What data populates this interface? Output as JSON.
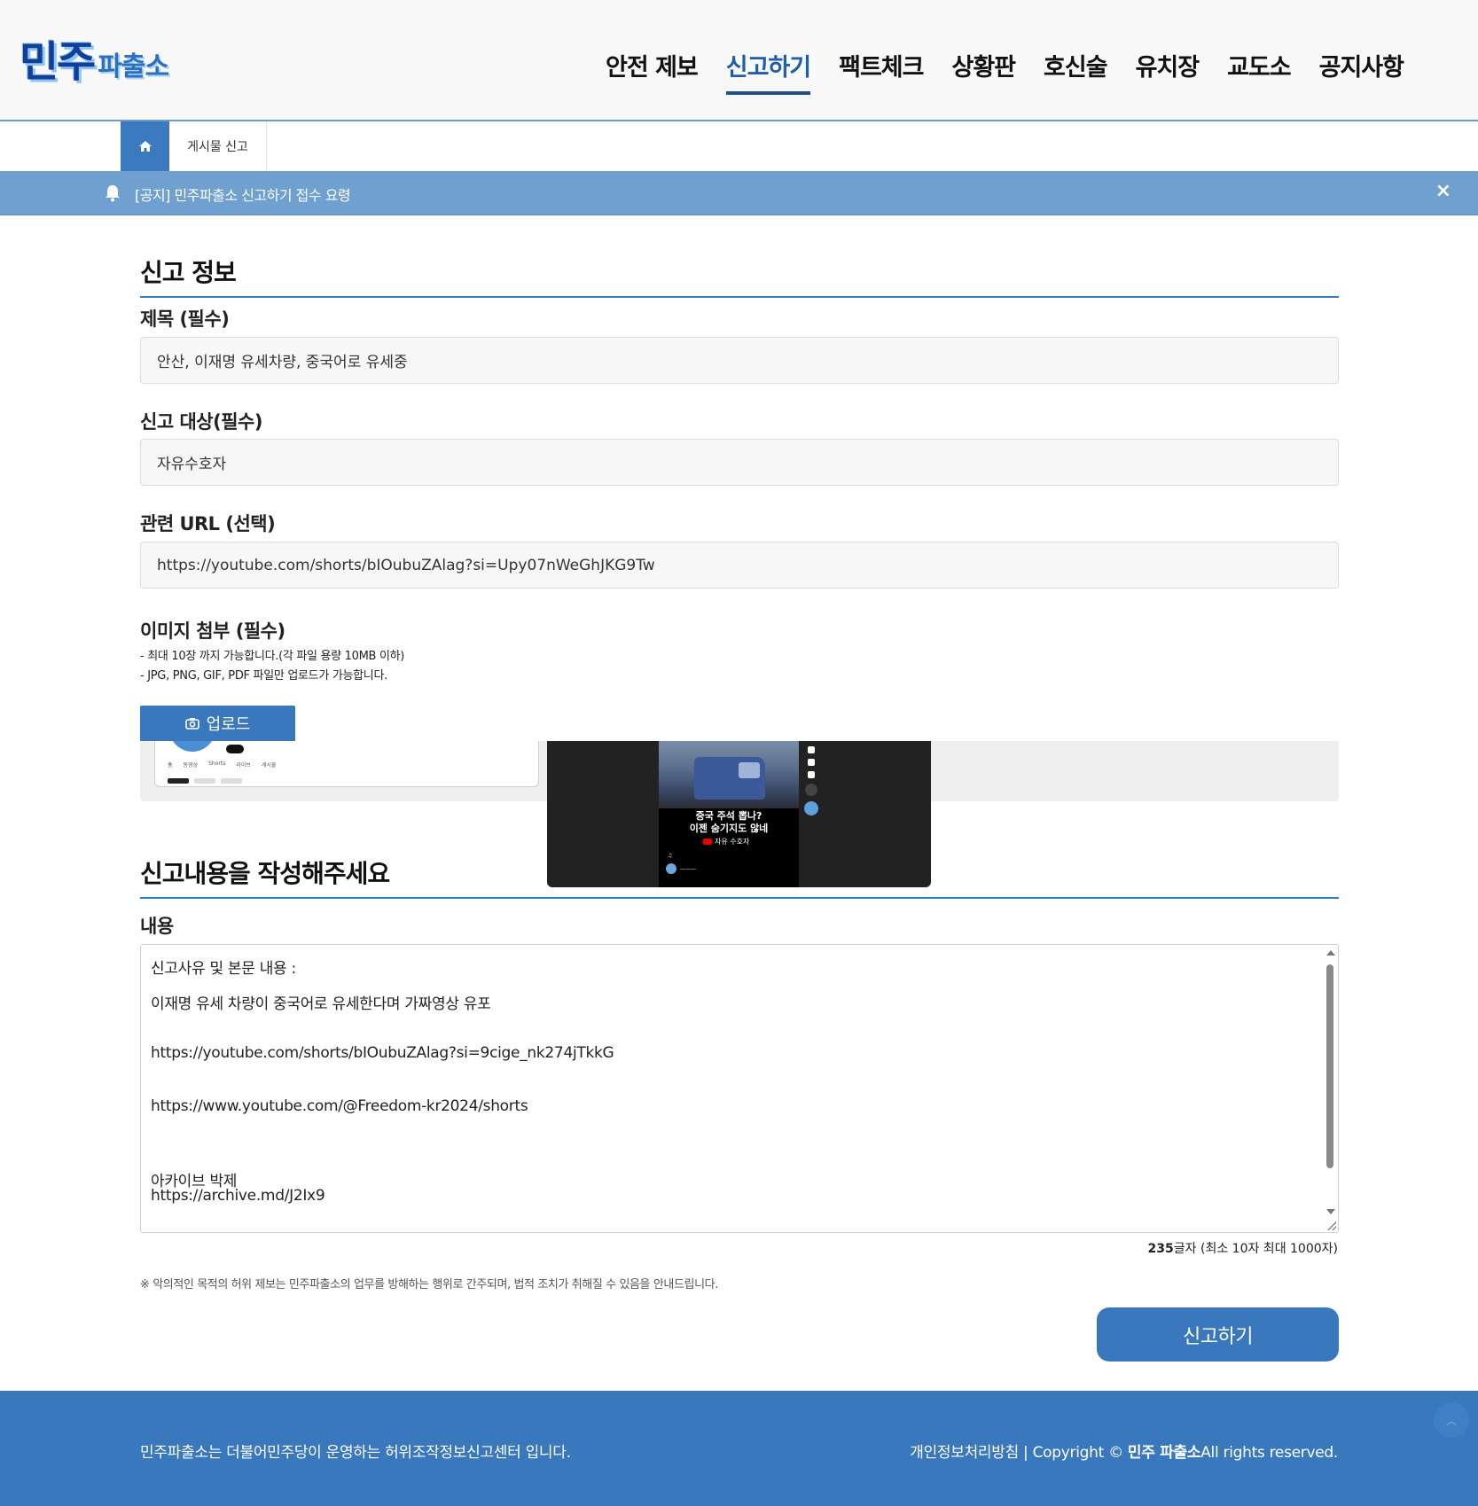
{
  "header": {
    "logo_main": "민주",
    "logo_sub": "파출소",
    "nav": [
      {
        "label": "안전 제보",
        "active": false
      },
      {
        "label": "신고하기",
        "active": true
      },
      {
        "label": "팩트체크",
        "active": false
      },
      {
        "label": "상황판",
        "active": false
      },
      {
        "label": "호신술",
        "active": false
      },
      {
        "label": "유치장",
        "active": false
      },
      {
        "label": "교도소",
        "active": false
      },
      {
        "label": "공지사항",
        "active": false
      }
    ]
  },
  "breadcrumb": {
    "home_icon": "home-icon",
    "current": "게시물 신고"
  },
  "notice": {
    "text": "[공지] 민주파출소 신고하기 접수 요령",
    "close": "×"
  },
  "report_info": {
    "section_title": "신고 정보",
    "title_label": "제목 (필수)",
    "title_value": "안산, 이재명 유세차량, 중국어로 유세중",
    "target_label": "신고 대상(필수)",
    "target_value": "자유수호자",
    "url_label": "관련 URL (선택)",
    "url_value": "https://youtube.com/shorts/bIOubuZAlag?si=Upy07nWeGhJKG9Tw",
    "image_label": "이미지 첨부 (필수)",
    "image_help_1": "- 최대 10장 까지 가능합니다.(각 파일 용량 10MB 이하)",
    "image_help_2": "- JPG, PNG, GIF, PDF 파일만 업로드가 가능합니다.",
    "upload_label": "업로드"
  },
  "preview": {
    "video_caption_1": "중국 주석 뽑나?",
    "video_caption_2": "이젠 숨기지도 않네",
    "video_channel": "자유 수호자"
  },
  "content": {
    "section_title": "신고내용을 작성해주세요",
    "content_label": "내용",
    "lines": [
      "신고사유 및 본문 내용 :",
      "이재명 유세 차량이 중국어로 유세한다며 가짜영상 유포",
      "https://youtube.com/shorts/bIOubuZAlag?si=9cige_nk274jTkkG",
      "https://www.youtube.com/@Freedom-kr2024/shorts",
      "아카이브 박제",
      "https://archive.md/J2Ix9"
    ],
    "char_count": "235",
    "char_suffix": "글자 (최소 10자 최대 1000자)",
    "warning": "※ 악의적인 목적의 허위 제보는 민주파출소의 업무를 방해하는 행위로 간주되며, 법적 조치가 취해질 수 있음을 안내드립니다.",
    "submit_label": "신고하기"
  },
  "footer": {
    "left": "민주파출소는 더불어민주당이 운영하는 허위조작정보신고센터 입니다.",
    "privacy": "개인정보처리방침 |",
    "copyright_prefix": "Copyright ©",
    "brand": "민주 파출소",
    "rights": "All rights reserved."
  },
  "colors": {
    "accent": "#3a78bd",
    "nav_active": "#1f5ea8",
    "notice_bg": "#6fa0cf"
  }
}
